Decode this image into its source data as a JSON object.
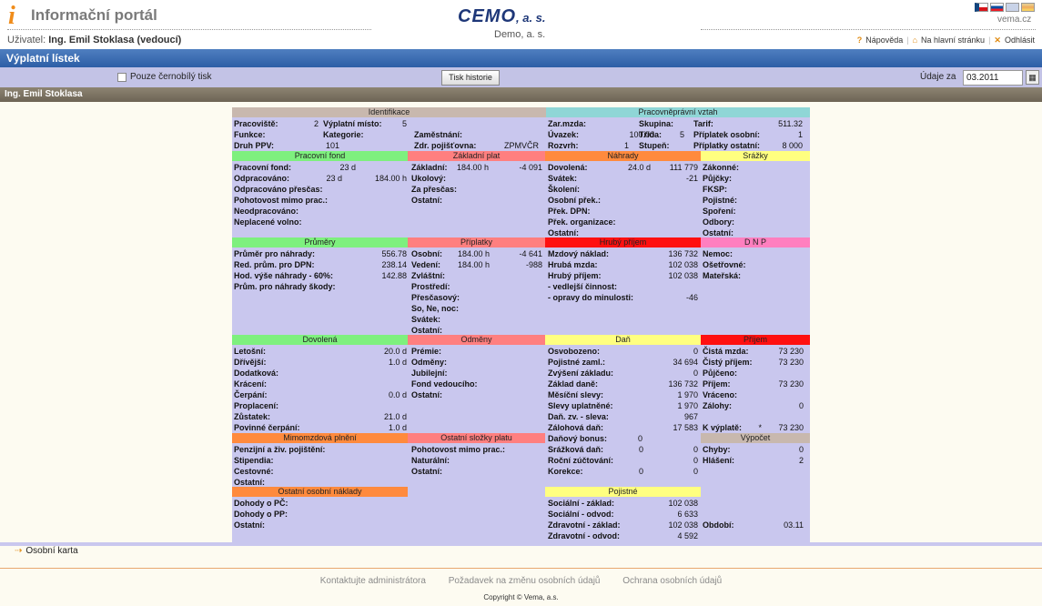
{
  "header": {
    "app_title": "Informační portál",
    "user_label": "Uživatel:",
    "user_name": "Ing. Emil Stoklasa (vedoucí)",
    "brand": "CEMO",
    "brand_suffix": ", a. s.",
    "company": "Demo, a. s.",
    "site": "vema.cz",
    "links": {
      "help": "Nápověda",
      "home": "Na hlavní stránku",
      "logout": "Odhlásit"
    }
  },
  "page_title": "Výplatní lístek",
  "toolbar": {
    "bw_label": "Pouze černobílý tisk",
    "history_button": "Tisk historie",
    "period_label": "Údaje za",
    "period_value": "03.2011"
  },
  "employee_name": "Ing. Emil Stoklasa",
  "sections": [
    {
      "id": "identifikace",
      "title": "Identifikace",
      "color": "#c8b8ae"
    },
    {
      "id": "pracovne",
      "title": "Pracovněprávní vztah",
      "color": "#8fd6d6"
    },
    {
      "id": "fond",
      "title": "Pracovní fond",
      "color": "#7ef07e"
    },
    {
      "id": "zaklad",
      "title": "Základní plat",
      "color": "#ff7f7f"
    },
    {
      "id": "nahrady",
      "title": "Náhrady",
      "color": "#ff8a3d"
    },
    {
      "id": "srazky",
      "title": "Srážky",
      "color": "#ffff80"
    },
    {
      "id": "prumery",
      "title": "Průměry",
      "color": "#7ef07e"
    },
    {
      "id": "priplatky",
      "title": "Příplatky",
      "color": "#ff7f7f"
    },
    {
      "id": "hruby",
      "title": "Hrubý příjem",
      "color": "#ff1010"
    },
    {
      "id": "dnp",
      "title": "D N P",
      "color": "#ff7fbf"
    },
    {
      "id": "dovolena",
      "title": "Dovolená",
      "color": "#7ef07e"
    },
    {
      "id": "odmeny",
      "title": "Odměny",
      "color": "#ff7f7f"
    },
    {
      "id": "dan",
      "title": "Daň",
      "color": "#ffff80"
    },
    {
      "id": "prijem",
      "title": "Příjem",
      "color": "#ff1010"
    },
    {
      "id": "mimomzdova",
      "title": "Mimomzdová plnění",
      "color": "#ff8a3d"
    },
    {
      "id": "ostatni_slozky",
      "title": "Ostatní složky platu",
      "color": "#ff7f7f"
    },
    {
      "id": "vypocet",
      "title": "Výpočet",
      "color": "#c8b8ae"
    },
    {
      "id": "ostatni_naklady",
      "title": "Ostatní osobní náklady",
      "color": "#ff8a3d"
    },
    {
      "id": "pojistne",
      "title": "Pojistné",
      "color": "#ffff80"
    }
  ],
  "rows": [
    {
      "l": "Pracoviště:",
      "v": "2"
    },
    {
      "l": "Výplatní místo:",
      "v": "5"
    },
    {
      "l": "Funkce:"
    },
    {
      "l": "Kategorie:"
    },
    {
      "l": "Zaměstnání:"
    },
    {
      "l": "Druh PPV:",
      "v": "101"
    },
    {
      "l": "Zdr. pojišťovna:",
      "v": "ZPMVČR"
    },
    {
      "l": "Zar.mzda:"
    },
    {
      "l": "Skupina:"
    },
    {
      "l": "Tarif:",
      "v": "511.32"
    },
    {
      "l": "Úvazek:",
      "v": "100.00"
    },
    {
      "l": "Třída:",
      "v": "5"
    },
    {
      "l": "Příplatek osobní:",
      "v": "1"
    },
    {
      "l": "Rozvrh:",
      "v": "1"
    },
    {
      "l": "Stupeň:"
    },
    {
      "l": "Příplatky ostatní:",
      "v": "8 000"
    },
    {
      "l": "Pracovní fond:",
      "v": "23 d"
    },
    {
      "l": "Odpracováno:",
      "v": "23 d",
      "v2": "184.00 h"
    },
    {
      "l": "Odpracováno přesčas:"
    },
    {
      "l": "Pohotovost mimo prac.:"
    },
    {
      "l": "Neodpracováno:"
    },
    {
      "l": "Neplacené volno:"
    },
    {
      "l": "Základní:",
      "v": "184.00 h",
      "v2": "-4 091"
    },
    {
      "l": "Ukolový:"
    },
    {
      "l": "Za přesčas:"
    },
    {
      "l": "Ostatní:"
    },
    {
      "l": "Dovolená:",
      "v": "24.0 d",
      "v2": "111 779"
    },
    {
      "l": "Svátek:",
      "v": "-21"
    },
    {
      "l": "Školení:"
    },
    {
      "l": "Osobní přek.:"
    },
    {
      "l": "Přek. DPN:"
    },
    {
      "l": "Přek. organizace:"
    },
    {
      "l": "Ostatní:"
    },
    {
      "l": "Zákonné:"
    },
    {
      "l": "Půjčky:"
    },
    {
      "l": "FKSP:"
    },
    {
      "l": "Pojistné:"
    },
    {
      "l": "Spoření:"
    },
    {
      "l": "Odbory:"
    },
    {
      "l": "Ostatní:"
    },
    {
      "l": "Průměr pro náhrady:",
      "v": "556.78"
    },
    {
      "l": "Red. prům. pro DPN:",
      "v": "238.14"
    },
    {
      "l": "Hod. výše náhrady - 60%:",
      "v": "142.88"
    },
    {
      "l": "Prům. pro náhrady škody:"
    },
    {
      "l": "Osobní:",
      "v": "184.00 h",
      "v2": "-4 641"
    },
    {
      "l": "Vedení:",
      "v": "184.00 h",
      "v2": "-988"
    },
    {
      "l": "Zvláštní:"
    },
    {
      "l": "Prostředí:"
    },
    {
      "l": "Přesčasový:"
    },
    {
      "l": "So, Ne, noc:"
    },
    {
      "l": "Svátek:"
    },
    {
      "l": "Ostatní:"
    },
    {
      "l": "Mzdový náklad:",
      "v": "136 732"
    },
    {
      "l": "Hrubá mzda:",
      "v": "102 038"
    },
    {
      "l": "Hrubý příjem:",
      "v": "102 038"
    },
    {
      "l": "- vedlejší činnost:"
    },
    {
      "l": "- opravy do minulosti:",
      "v": "-46"
    },
    {
      "l": "Nemoc:"
    },
    {
      "l": "Ošetřovné:"
    },
    {
      "l": "Mateřská:"
    },
    {
      "l": "Letošní:",
      "v": "20.0 d"
    },
    {
      "l": "Dřívější:",
      "v": "1.0 d"
    },
    {
      "l": "Dodatková:"
    },
    {
      "l": "Krácení:"
    },
    {
      "l": "Čerpání:",
      "v": "0.0 d"
    },
    {
      "l": "Proplacení:"
    },
    {
      "l": "Zůstatek:",
      "v": "21.0 d"
    },
    {
      "l": "Povinné čerpání:",
      "v": "1.0 d"
    },
    {
      "l": "Prémie:"
    },
    {
      "l": "Odměny:"
    },
    {
      "l": "Jubilejní:"
    },
    {
      "l": "Fond vedoucího:"
    },
    {
      "l": "Ostatní:"
    },
    {
      "l": "Osvobozeno:",
      "v": "0"
    },
    {
      "l": "Pojistné zaml.:",
      "v": "34 694"
    },
    {
      "l": "Zvýšení základu:",
      "v": "0"
    },
    {
      "l": "Základ daně:",
      "v": "136 732"
    },
    {
      "l": "Měsíční slevy:",
      "v": "1 970"
    },
    {
      "l": "Slevy uplatněné:",
      "v": "1 970"
    },
    {
      "l": "Daň. zv. - sleva:",
      "v": "967"
    },
    {
      "l": "Zálohová daň:",
      "v": "17 583"
    },
    {
      "l": "Daňový bonus:",
      "v": "0"
    },
    {
      "l": "Srážková daň:",
      "v": "0",
      "v2": "0"
    },
    {
      "l": "Roční zúčtování:",
      "v": "0"
    },
    {
      "l": "Korekce:",
      "v": "0",
      "v2": "0"
    },
    {
      "l": "Čistá mzda:",
      "v": "73 230"
    },
    {
      "l": "Čistý příjem:",
      "v": "73 230"
    },
    {
      "l": "Půjčeno:"
    },
    {
      "l": "Příjem:",
      "v": "73 230"
    },
    {
      "l": "Vráceno:"
    },
    {
      "l": "Zálohy:",
      "v": "0"
    },
    {
      "l": "K výplatě:",
      "v": "*",
      "v2": "73 230"
    },
    {
      "l": "Penzijní a živ. pojištění:"
    },
    {
      "l": "Stipendia:"
    },
    {
      "l": "Cestovné:"
    },
    {
      "l": "Ostatní:"
    },
    {
      "l": "Pohotovost mimo prac.:"
    },
    {
      "l": "Naturální:"
    },
    {
      "l": "Ostatní:"
    },
    {
      "l": "Chyby:",
      "v": "0"
    },
    {
      "l": "Hlášení:",
      "v": "2"
    },
    {
      "l": "Dohody o PČ:"
    },
    {
      "l": "Dohody o PP:"
    },
    {
      "l": "Ostatní:"
    },
    {
      "l": "Sociální - základ:",
      "v": "102 038"
    },
    {
      "l": "Sociální - odvod:",
      "v": "6 633"
    },
    {
      "l": "Zdravotní - základ:",
      "v": "102 038"
    },
    {
      "l": "Zdravotní - odvod:",
      "v": "4 592"
    },
    {
      "l": "Období:",
      "v": "03.11"
    }
  ],
  "bottom_link": "Osobní karta",
  "footer": {
    "contact": "Kontaktujte administrátora",
    "change": "Požadavek na změnu osobních údajů",
    "privacy": "Ochrana osobních údajů",
    "copyright": "Copyright © Vema, a.s."
  }
}
